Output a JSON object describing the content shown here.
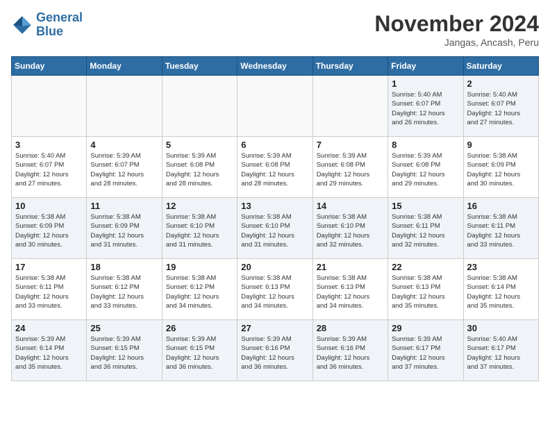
{
  "header": {
    "logo_line1": "General",
    "logo_line2": "Blue",
    "month": "November 2024",
    "location": "Jangas, Ancash, Peru"
  },
  "weekdays": [
    "Sunday",
    "Monday",
    "Tuesday",
    "Wednesday",
    "Thursday",
    "Friday",
    "Saturday"
  ],
  "weeks": [
    [
      {
        "day": "",
        "detail": ""
      },
      {
        "day": "",
        "detail": ""
      },
      {
        "day": "",
        "detail": ""
      },
      {
        "day": "",
        "detail": ""
      },
      {
        "day": "",
        "detail": ""
      },
      {
        "day": "1",
        "detail": "Sunrise: 5:40 AM\nSunset: 6:07 PM\nDaylight: 12 hours\nand 26 minutes."
      },
      {
        "day": "2",
        "detail": "Sunrise: 5:40 AM\nSunset: 6:07 PM\nDaylight: 12 hours\nand 27 minutes."
      }
    ],
    [
      {
        "day": "3",
        "detail": "Sunrise: 5:40 AM\nSunset: 6:07 PM\nDaylight: 12 hours\nand 27 minutes."
      },
      {
        "day": "4",
        "detail": "Sunrise: 5:39 AM\nSunset: 6:07 PM\nDaylight: 12 hours\nand 28 minutes."
      },
      {
        "day": "5",
        "detail": "Sunrise: 5:39 AM\nSunset: 6:08 PM\nDaylight: 12 hours\nand 28 minutes."
      },
      {
        "day": "6",
        "detail": "Sunrise: 5:39 AM\nSunset: 6:08 PM\nDaylight: 12 hours\nand 28 minutes."
      },
      {
        "day": "7",
        "detail": "Sunrise: 5:39 AM\nSunset: 6:08 PM\nDaylight: 12 hours\nand 29 minutes."
      },
      {
        "day": "8",
        "detail": "Sunrise: 5:39 AM\nSunset: 6:08 PM\nDaylight: 12 hours\nand 29 minutes."
      },
      {
        "day": "9",
        "detail": "Sunrise: 5:38 AM\nSunset: 6:09 PM\nDaylight: 12 hours\nand 30 minutes."
      }
    ],
    [
      {
        "day": "10",
        "detail": "Sunrise: 5:38 AM\nSunset: 6:09 PM\nDaylight: 12 hours\nand 30 minutes."
      },
      {
        "day": "11",
        "detail": "Sunrise: 5:38 AM\nSunset: 6:09 PM\nDaylight: 12 hours\nand 31 minutes."
      },
      {
        "day": "12",
        "detail": "Sunrise: 5:38 AM\nSunset: 6:10 PM\nDaylight: 12 hours\nand 31 minutes."
      },
      {
        "day": "13",
        "detail": "Sunrise: 5:38 AM\nSunset: 6:10 PM\nDaylight: 12 hours\nand 31 minutes."
      },
      {
        "day": "14",
        "detail": "Sunrise: 5:38 AM\nSunset: 6:10 PM\nDaylight: 12 hours\nand 32 minutes."
      },
      {
        "day": "15",
        "detail": "Sunrise: 5:38 AM\nSunset: 6:11 PM\nDaylight: 12 hours\nand 32 minutes."
      },
      {
        "day": "16",
        "detail": "Sunrise: 5:38 AM\nSunset: 6:11 PM\nDaylight: 12 hours\nand 33 minutes."
      }
    ],
    [
      {
        "day": "17",
        "detail": "Sunrise: 5:38 AM\nSunset: 6:11 PM\nDaylight: 12 hours\nand 33 minutes."
      },
      {
        "day": "18",
        "detail": "Sunrise: 5:38 AM\nSunset: 6:12 PM\nDaylight: 12 hours\nand 33 minutes."
      },
      {
        "day": "19",
        "detail": "Sunrise: 5:38 AM\nSunset: 6:12 PM\nDaylight: 12 hours\nand 34 minutes."
      },
      {
        "day": "20",
        "detail": "Sunrise: 5:38 AM\nSunset: 6:13 PM\nDaylight: 12 hours\nand 34 minutes."
      },
      {
        "day": "21",
        "detail": "Sunrise: 5:38 AM\nSunset: 6:13 PM\nDaylight: 12 hours\nand 34 minutes."
      },
      {
        "day": "22",
        "detail": "Sunrise: 5:38 AM\nSunset: 6:13 PM\nDaylight: 12 hours\nand 35 minutes."
      },
      {
        "day": "23",
        "detail": "Sunrise: 5:38 AM\nSunset: 6:14 PM\nDaylight: 12 hours\nand 35 minutes."
      }
    ],
    [
      {
        "day": "24",
        "detail": "Sunrise: 5:39 AM\nSunset: 6:14 PM\nDaylight: 12 hours\nand 35 minutes."
      },
      {
        "day": "25",
        "detail": "Sunrise: 5:39 AM\nSunset: 6:15 PM\nDaylight: 12 hours\nand 36 minutes."
      },
      {
        "day": "26",
        "detail": "Sunrise: 5:39 AM\nSunset: 6:15 PM\nDaylight: 12 hours\nand 36 minutes."
      },
      {
        "day": "27",
        "detail": "Sunrise: 5:39 AM\nSunset: 6:16 PM\nDaylight: 12 hours\nand 36 minutes."
      },
      {
        "day": "28",
        "detail": "Sunrise: 5:39 AM\nSunset: 6:16 PM\nDaylight: 12 hours\nand 36 minutes."
      },
      {
        "day": "29",
        "detail": "Sunrise: 5:39 AM\nSunset: 6:17 PM\nDaylight: 12 hours\nand 37 minutes."
      },
      {
        "day": "30",
        "detail": "Sunrise: 5:40 AM\nSunset: 6:17 PM\nDaylight: 12 hours\nand 37 minutes."
      }
    ]
  ]
}
